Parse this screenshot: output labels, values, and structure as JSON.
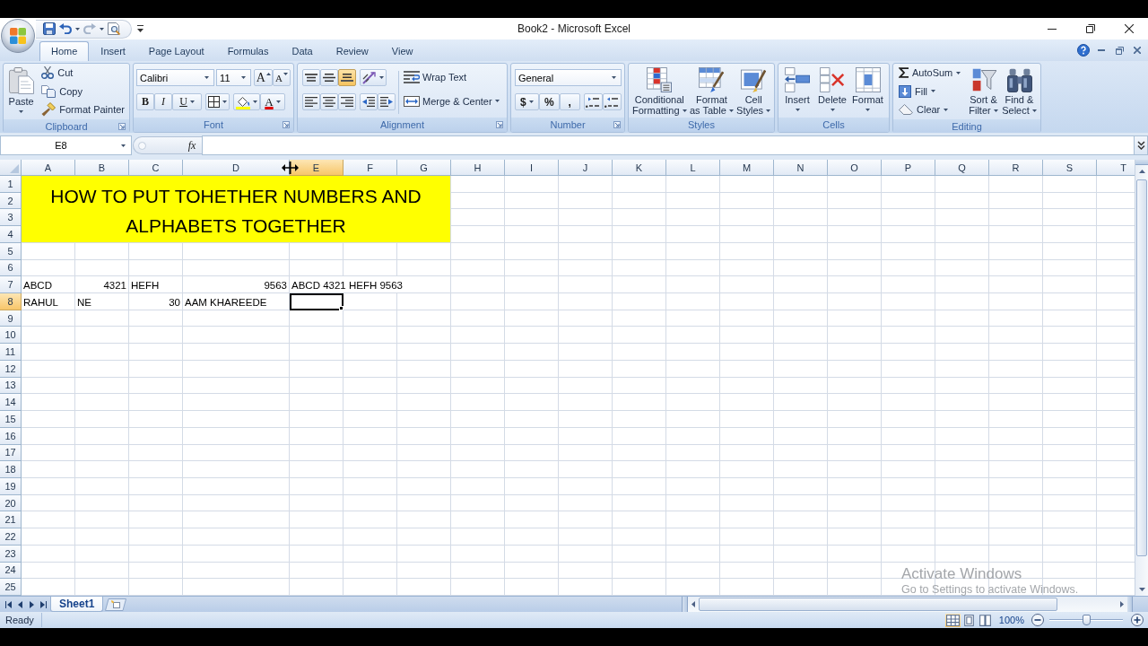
{
  "title_bar": {
    "title": "Book2 - Microsoft Excel"
  },
  "ribbon_tabs": [
    {
      "label": "Home",
      "selected": true
    },
    {
      "label": "Insert",
      "selected": false
    },
    {
      "label": "Page Layout",
      "selected": false
    },
    {
      "label": "Formulas",
      "selected": false
    },
    {
      "label": "Data",
      "selected": false
    },
    {
      "label": "Review",
      "selected": false
    },
    {
      "label": "View",
      "selected": false
    }
  ],
  "clipboard": {
    "paste": "Paste",
    "cut": "Cut",
    "copy": "Copy",
    "format_painter": "Format Painter",
    "label": "Clipboard"
  },
  "font": {
    "font_name": "Calibri",
    "font_size": "11",
    "grow_font": "A",
    "shrink_font": "A",
    "bold": "B",
    "italic": "I",
    "underline": "U",
    "font_color": "A",
    "label": "Font"
  },
  "alignment": {
    "vertical_align": [
      {
        "selected": false
      },
      {
        "selected": false
      },
      {
        "selected": true
      }
    ],
    "wrap_text": "Wrap Text",
    "merge_center": "Merge & Center",
    "label": "Alignment"
  },
  "number": {
    "format": "General",
    "currency": "$",
    "percent": "%",
    "comma": ",",
    "label": "Number"
  },
  "styles": {
    "buttons": [
      "Conditional\nFormatting",
      "Format\nas Table",
      "Cell\nStyles"
    ],
    "label": "Styles"
  },
  "cells": {
    "buttons": [
      "Insert",
      "Delete",
      "Format"
    ],
    "label": "Cells"
  },
  "editing": {
    "autosum": "AutoSum",
    "fill": "Fill",
    "clear": "Clear",
    "sort_filter": "Sort &\nFilter",
    "find_select": "Find &\nSelect",
    "label": "Editing"
  },
  "formula_bar": {
    "name_box": "E8",
    "function_button": "fx"
  },
  "sheet": {
    "columns": [
      {
        "label": "A",
        "selected": false
      },
      {
        "label": "B",
        "selected": false
      },
      {
        "label": "C",
        "selected": false
      },
      {
        "label": "D",
        "selected": false
      },
      {
        "label": "E",
        "selected": true
      },
      {
        "label": "F",
        "selected": false
      },
      {
        "label": "G",
        "selected": false
      },
      {
        "label": "H",
        "selected": false
      },
      {
        "label": "I",
        "selected": false
      },
      {
        "label": "J",
        "selected": false
      },
      {
        "label": "K",
        "selected": false
      },
      {
        "label": "L",
        "selected": false
      },
      {
        "label": "M",
        "selected": false
      },
      {
        "label": "N",
        "selected": false
      },
      {
        "label": "O",
        "selected": false
      },
      {
        "label": "P",
        "selected": false
      },
      {
        "label": "Q",
        "selected": false
      },
      {
        "label": "R",
        "selected": false
      },
      {
        "label": "S",
        "selected": false
      },
      {
        "label": "T",
        "selected": false
      }
    ],
    "title_cell": "HOW TO PUT TOHETHER NUMBERS AND ALPHABETS TOGETHER",
    "rows": [
      {
        "number": "1",
        "selected": false
      },
      {
        "number": "2",
        "selected": false
      },
      {
        "number": "3",
        "selected": false
      },
      {
        "number": "4",
        "selected": false
      },
      {
        "number": "5",
        "selected": false
      },
      {
        "number": "6",
        "selected": false
      },
      {
        "number": "7",
        "selected": false,
        "cells": [
          {
            "kind": "text",
            "text": "ABCD"
          },
          {
            "kind": "number",
            "text": "4321"
          },
          {
            "kind": "text",
            "text": "HEFH"
          },
          {
            "kind": "number",
            "text": "9563"
          },
          {
            "kind": "text",
            "text": "ABCD 4321 HEFH 9563"
          }
        ]
      },
      {
        "number": "8",
        "selected": true,
        "cells": [
          {
            "kind": "text",
            "text": "RAHUL"
          },
          {
            "kind": "text",
            "text": "NE"
          },
          {
            "kind": "number",
            "text": "30"
          },
          {
            "kind": "text",
            "text": "AAM KHAREEDE"
          }
        ]
      },
      {
        "number": "9",
        "selected": false
      },
      {
        "number": "10",
        "selected": false
      },
      {
        "number": "11",
        "selected": false
      },
      {
        "number": "12",
        "selected": false
      },
      {
        "number": "13",
        "selected": false
      },
      {
        "number": "14",
        "selected": false
      },
      {
        "number": "15",
        "selected": false
      },
      {
        "number": "16",
        "selected": false
      },
      {
        "number": "17",
        "selected": false
      },
      {
        "number": "18",
        "selected": false
      },
      {
        "number": "19",
        "selected": false
      },
      {
        "number": "20",
        "selected": false
      },
      {
        "number": "21",
        "selected": false
      },
      {
        "number": "22",
        "selected": false
      },
      {
        "number": "23",
        "selected": false
      },
      {
        "number": "24",
        "selected": false
      },
      {
        "number": "25",
        "selected": false
      }
    ]
  },
  "sheet_tabs": [
    {
      "label": "Sheet1",
      "selected": true
    }
  ],
  "status_bar": {
    "status": "Ready",
    "views": [
      {
        "selected": true
      },
      {
        "selected": false
      },
      {
        "selected": false
      }
    ],
    "zoom": "100%",
    "zoom_slider": {
      "level": 0.5
    }
  },
  "activation_notice": {
    "title": "Activate Windows",
    "message": "Go to Settings to activate Windows."
  }
}
